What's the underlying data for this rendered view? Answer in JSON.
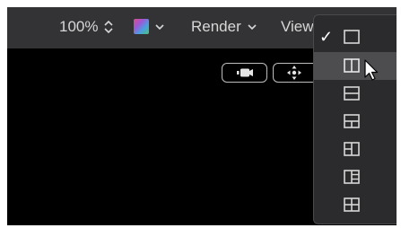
{
  "toolbar": {
    "zoom_label": "100%",
    "render_label": "Render",
    "view_label": "View"
  },
  "viewer_controls": {
    "camera_icon": "camera-icon",
    "transform_icon": "move-arrows-icon"
  },
  "view_menu": {
    "items": [
      {
        "icon": "layout-single-icon",
        "checked": true
      },
      {
        "icon": "layout-split-vertical-icon",
        "highlighted": true
      },
      {
        "icon": "layout-split-horizontal-icon"
      },
      {
        "icon": "layout-top-split-icon"
      },
      {
        "icon": "layout-left-split-icon"
      },
      {
        "icon": "layout-right-split-icon"
      },
      {
        "icon": "layout-quad-icon"
      }
    ],
    "check_mark": "✓"
  },
  "colors": {
    "toolbar_bg": "#333335",
    "menu_bg": "#2b2b2d",
    "menu_highlight": "#4d4d50",
    "icon": "#d7d7d7"
  }
}
